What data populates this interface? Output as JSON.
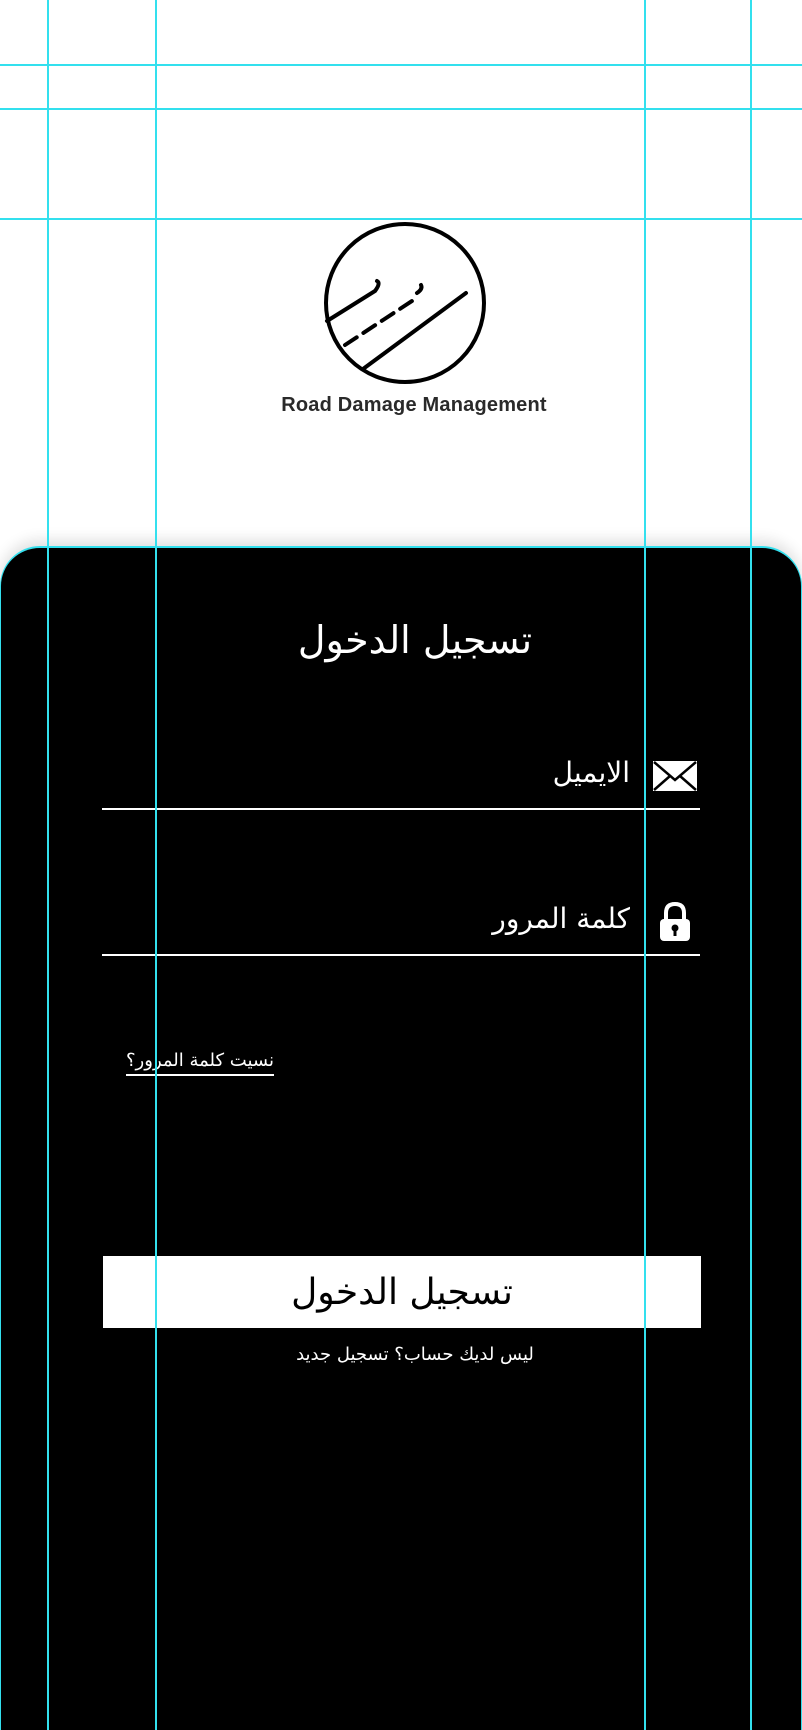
{
  "header": {
    "app_name": "Road Damage Management",
    "logo_icon": "road-circle-icon"
  },
  "login": {
    "title": "تسجيل الدخول",
    "email": {
      "label": "الايميل",
      "icon": "envelope-icon",
      "value": ""
    },
    "password": {
      "label": "كلمة المرور",
      "icon": "lock-icon",
      "value": ""
    },
    "forgot_password": "نسيت كلمة المرور؟",
    "submit_label": "تسجيل الدخول",
    "signup_prompt": "ليس لديك حساب؟ تسجيل جديد"
  },
  "colors": {
    "panel_background": "#000000",
    "page_background": "#ffffff",
    "text_on_panel": "#ffffff",
    "guide_lines": "#33e0ee"
  }
}
